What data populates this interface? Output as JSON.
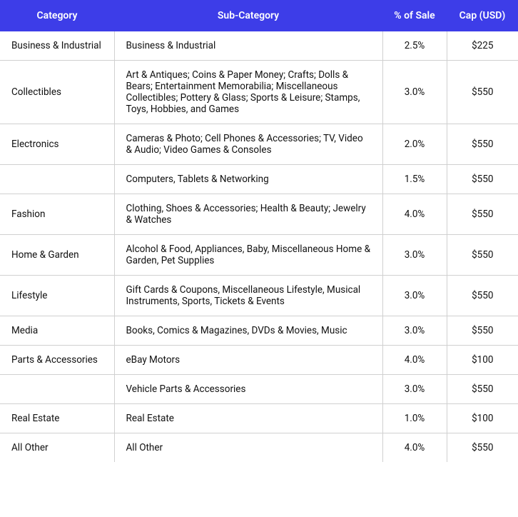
{
  "table": {
    "headers": {
      "category": "Category",
      "subcategory": "Sub-Category",
      "percent_sale": "% of Sale",
      "cap_usd": "Cap (USD)"
    },
    "rows": [
      {
        "category": "Business & Industrial",
        "subcategory": "Business & Industrial",
        "percent_sale": "2.5%",
        "cap_usd": "$225",
        "rowspan": 1
      },
      {
        "category": "Collectibles",
        "subcategory": "Art & Antiques; Coins & Paper Money; Crafts; Dolls & Bears; Entertainment Memorabilia; Miscellaneous Collectibles; Pottery & Glass; Sports & Leisure; Stamps, Toys, Hobbies, and Games",
        "percent_sale": "3.0%",
        "cap_usd": "$550",
        "rowspan": 1
      },
      {
        "category": "Electronics",
        "subcategory": "Cameras & Photo; Cell Phones & Accessories; TV, Video & Audio; Video Games & Consoles",
        "percent_sale": "2.0%",
        "cap_usd": "$550",
        "rowspan": 1
      },
      {
        "category": "",
        "subcategory": "Computers, Tablets & Networking",
        "percent_sale": "1.5%",
        "cap_usd": "$550",
        "rowspan": 1
      },
      {
        "category": "Fashion",
        "subcategory": "Clothing, Shoes & Accessories; Health & Beauty; Jewelry & Watches",
        "percent_sale": "4.0%",
        "cap_usd": "$550",
        "rowspan": 1
      },
      {
        "category": "Home & Garden",
        "subcategory": "Alcohol & Food, Appliances, Baby, Miscellaneous Home & Garden, Pet Supplies",
        "percent_sale": "3.0%",
        "cap_usd": "$550",
        "rowspan": 1
      },
      {
        "category": "Lifestyle",
        "subcategory": "Gift Cards & Coupons, Miscellaneous Lifestyle, Musical Instruments, Sports, Tickets & Events",
        "percent_sale": "3.0%",
        "cap_usd": "$550",
        "rowspan": 1
      },
      {
        "category": "Media",
        "subcategory": "Books, Comics & Magazines, DVDs & Movies, Music",
        "percent_sale": "3.0%",
        "cap_usd": "$550",
        "rowspan": 1
      },
      {
        "category": "Parts & Accessories",
        "subcategory": "eBay Motors",
        "percent_sale": "4.0%",
        "cap_usd": "$100",
        "rowspan": 1
      },
      {
        "category": "",
        "subcategory": "Vehicle Parts & Accessories",
        "percent_sale": "3.0%",
        "cap_usd": "$550",
        "rowspan": 1
      },
      {
        "category": "Real Estate",
        "subcategory": "Real Estate",
        "percent_sale": "1.0%",
        "cap_usd": "$100",
        "rowspan": 1
      },
      {
        "category": "All Other",
        "subcategory": "All Other",
        "percent_sale": "4.0%",
        "cap_usd": "$550",
        "rowspan": 1
      }
    ]
  }
}
